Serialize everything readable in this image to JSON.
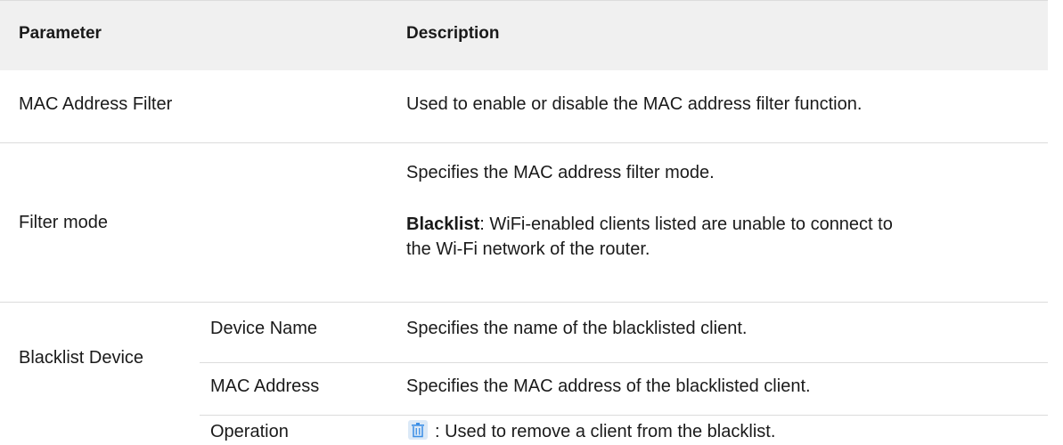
{
  "header": {
    "parameter": "Parameter",
    "description": "Description"
  },
  "rows": {
    "mac_filter": {
      "parameter": "MAC Address Filter",
      "description": "Used to enable or disable the MAC address filter function."
    },
    "filter_mode": {
      "parameter": "Filter mode",
      "description": "Specifies the MAC address filter mode.",
      "term": "Blacklist",
      "term_desc_line1": ": WiFi-enabled clients listed are unable to connect to",
      "term_desc_line2": "the Wi-Fi network of the router."
    },
    "blacklist_device": {
      "parameter": "Blacklist Device",
      "sub": [
        {
          "name": "Device Name",
          "description": "Specifies the name of the blacklisted client."
        },
        {
          "name": "MAC Address",
          "description": "Specifies the MAC address of the blacklisted client."
        },
        {
          "name": "Operation",
          "icon": "trash-icon",
          "description": ": Used to remove a client from the blacklist."
        }
      ]
    }
  },
  "colors": {
    "header_bg": "#f0f0f0",
    "divider": "#dcdcdc",
    "icon_bg": "#dbe9f7",
    "icon_fg": "#3a8ee6"
  }
}
